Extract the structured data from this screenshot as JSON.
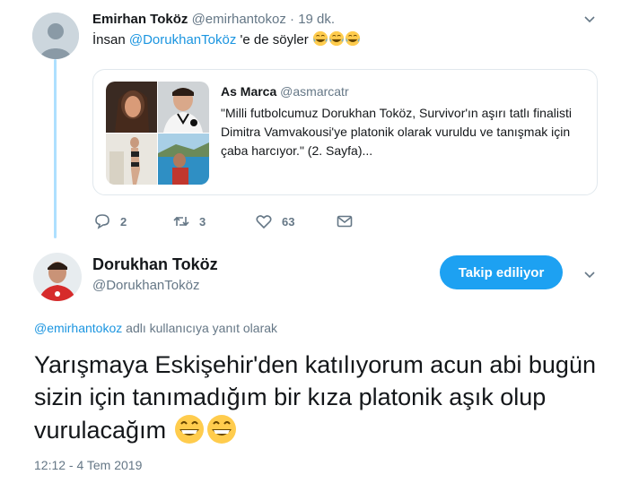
{
  "tweet1": {
    "name": "Emirhan Toköz",
    "handle": "@emirhantokoz",
    "time": "· 19 dk.",
    "text_prefix": "İnsan",
    "mention": "@DorukhanToköz",
    "text_suffix": "'e de söyler",
    "emoji": [
      "face-with-tears-of-joy-emoji",
      "face-with-tears-of-joy-emoji",
      "face-with-tears-of-joy-emoji"
    ]
  },
  "quote": {
    "name": "As Marca",
    "handle": "@asmarcatr",
    "text": "\"Milli futbolcumuz Dorukhan Toköz, Survivor'ın aşırı tatlı finalisti Dimitra Vamvakousi'ye platonik olarak vuruldu ve tanışmak için çaba harcıyor.\" (2. Sayfa)..."
  },
  "actions": {
    "reply_count": "2",
    "retweet_count": "3",
    "like_count": "63"
  },
  "tweet2": {
    "name": "Dorukhan Toköz",
    "handle": "@DorukhanToköz",
    "follow_label": "Takip ediliyor",
    "reply_to_mention": "@emirhantokoz",
    "reply_to_suffix": "adlı kullanıcıya yanıt olarak",
    "text": "Yarışmaya Eskişehir'den katılıyorum acun abi bugün sizin için tanımadığım bir kıza platonik aşık olup vurulacağım",
    "emoji": [
      "grinning-face-emoji",
      "grinning-face-emoji"
    ],
    "timestamp": "12:12 - 4 Tem 2019"
  },
  "colors": {
    "accent": "#1da1f2",
    "link": "#1b95e0",
    "muted": "#657786",
    "thread_line": "#aee0ff"
  }
}
